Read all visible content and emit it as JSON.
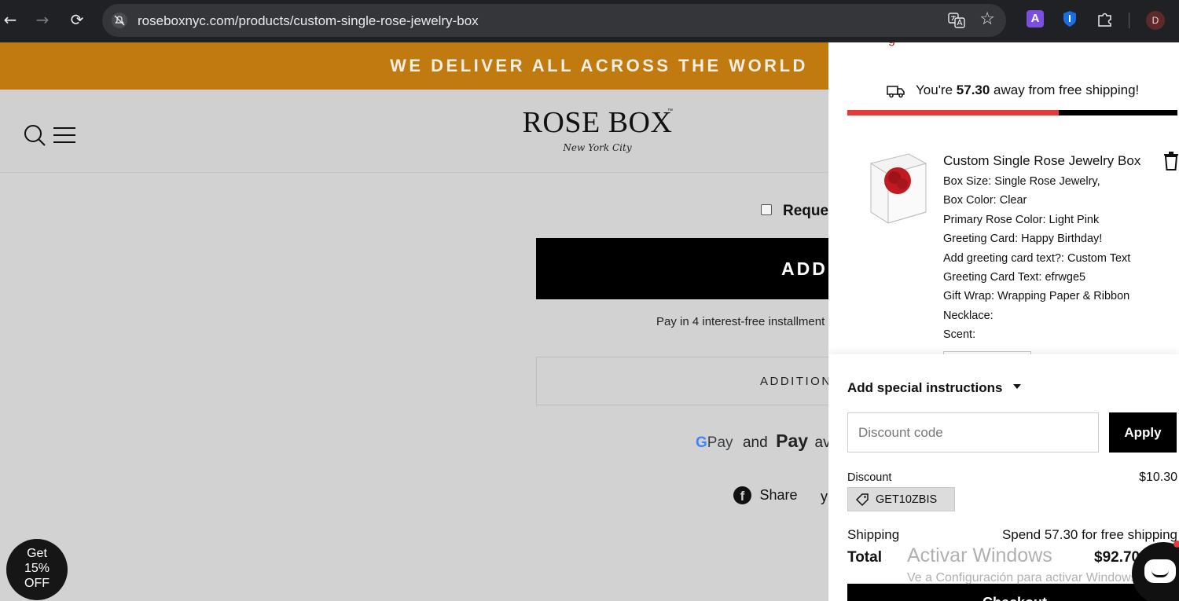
{
  "browser": {
    "url": "roseboxnyc.com/products/custom-single-rose-jewelry-box",
    "back_glyph": "←",
    "forward_glyph": "→",
    "reload_glyph": "⟳",
    "star_glyph": "☆",
    "ext_a_letter": "A",
    "profile_initial": "D"
  },
  "site": {
    "announcement": "WE DELIVER ALL ACROSS THE WORLD",
    "logo_wordmark": "ROSE BOX",
    "logo_tm": "™",
    "logo_subtitle": "New York City",
    "accent_color": "#c07a10"
  },
  "product": {
    "request_label": "Reques",
    "add_button": "ADD",
    "installments": "Pay in 4 interest-free installment",
    "additional": "ADDITION",
    "payments": {
      "g": "G",
      "gpay": "Pay",
      "and": "and",
      "apple": "",
      "apple_pay": "Pay",
      "rest": "av"
    },
    "share_label": "Share",
    "facebook_letter": "f",
    "twitter_glyph": "y"
  },
  "promo": {
    "line1": "Get",
    "line2": "15%",
    "line3": "OFF"
  },
  "cart": {
    "clipped_top": "g",
    "shipping_prefix": "You're ",
    "shipping_amount": "57.30",
    "shipping_suffix": " away from free shipping!",
    "shipping_progress": 0.64,
    "item": {
      "title": "Custom Single Rose Jewelry Box",
      "properties": [
        "Box Size: Single Rose Jewelry,",
        "Box Color: Clear",
        "Primary Rose Color: Light Pink",
        "Greeting Card: Happy Birthday!",
        "Add greeting card text?: Custom Text",
        "Greeting Card Text: efrwge5",
        "Gift Wrap: Wrapping Paper & Ribbon",
        "Necklace:",
        "Scent:"
      ]
    },
    "special_instructions": "Add special instructions",
    "discount_placeholder": "Discount code",
    "apply": "Apply",
    "discount_label": "Discount",
    "discount_amount": "$10.30",
    "discount_code": "GET10ZBIS",
    "shipping_label": "Shipping",
    "shipping_value": "Spend 57.30 for free shipping",
    "total_label": "Total",
    "total_value": "$92.70",
    "checkout": "Checkout"
  },
  "os_watermark": {
    "line1": "Activar Windows",
    "line2": "Ve a Configuración para activar Windows."
  }
}
